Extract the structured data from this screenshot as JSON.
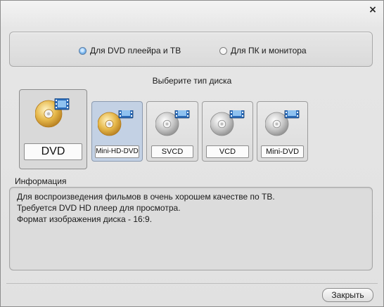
{
  "window": {
    "close_label": "×"
  },
  "mode": {
    "options": [
      {
        "label": "Для DVD плеейра и ТВ",
        "checked": true
      },
      {
        "label": "Для ПК и монитора",
        "checked": false
      }
    ]
  },
  "disc_prompt": "Выберите тип диска",
  "disc_types": [
    {
      "label": "DVD",
      "selected": true,
      "disc_color": "gold"
    },
    {
      "label": "Mini-HD-DVD",
      "selected": false,
      "hover": true,
      "disc_color": "gold"
    },
    {
      "label": "SVCD",
      "selected": false,
      "disc_color": "silver"
    },
    {
      "label": "VCD",
      "selected": false,
      "disc_color": "silver"
    },
    {
      "label": "Mini-DVD",
      "selected": false,
      "disc_color": "silver"
    }
  ],
  "info": {
    "title": "Информация",
    "lines": [
      "Для воспроизведения фильмов в очень хорошем качестве по ТВ.",
      "Требуется DVD HD плеер для просмотра.",
      "Формат изображения диска - 16:9."
    ]
  },
  "ok_button": "Закрыть"
}
